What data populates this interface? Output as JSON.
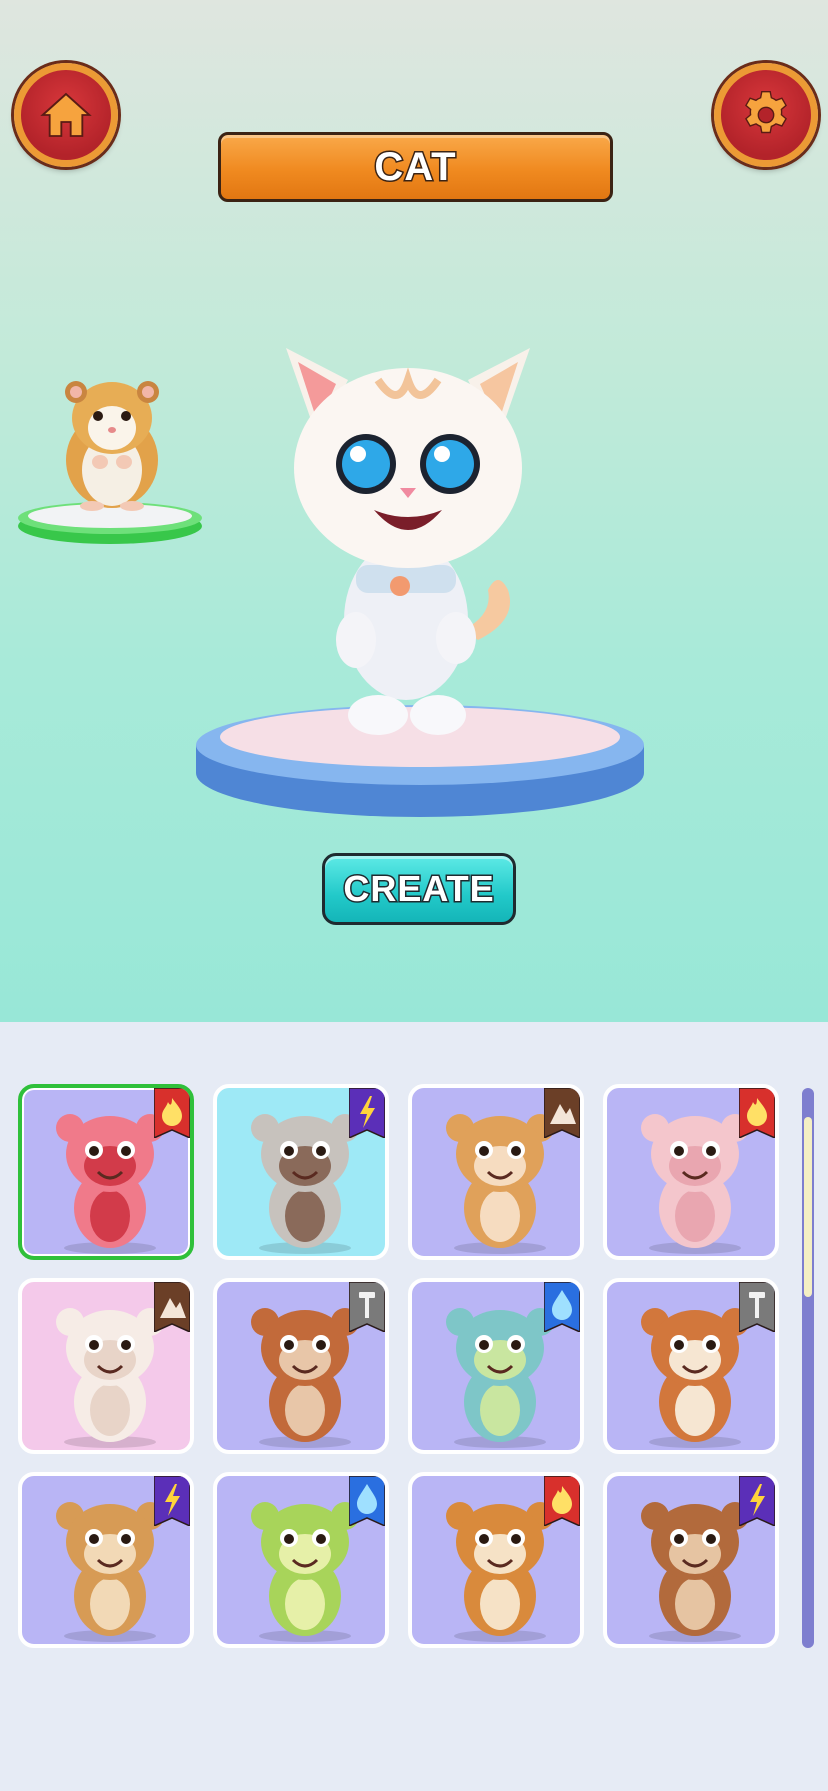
{
  "header": {
    "title": "CAT",
    "home_icon": "home-icon",
    "settings_icon": "gear-icon"
  },
  "stage": {
    "main_character": "cat",
    "side_character": "hamster",
    "create_label": "CREATE"
  },
  "colors": {
    "fire": "#d8302c",
    "lightning": "#5b2fb8",
    "mountain": "#6b3f27",
    "metal": "#7a7a7a",
    "water": "#2a6fe0",
    "selected_border": "#2fc03a"
  },
  "grid": {
    "cards": [
      {
        "animal": "robot-cat",
        "bg": "#b9b5f5",
        "element": "fire",
        "icon": "fire-icon",
        "selected": true
      },
      {
        "animal": "dog",
        "bg": "#9ee9f6",
        "element": "lightning",
        "icon": "lightning-icon",
        "selected": false
      },
      {
        "animal": "monkey",
        "bg": "#b9b5f5",
        "element": "mountain",
        "icon": "mountain-icon",
        "selected": false
      },
      {
        "animal": "pig",
        "bg": "#b9b5f5",
        "element": "fire",
        "icon": "fire-icon",
        "selected": false
      },
      {
        "animal": "fluffy-cat",
        "bg": "#f4c9ea",
        "element": "mountain",
        "icon": "mountain-icon",
        "selected": false
      },
      {
        "animal": "puppy",
        "bg": "#b9b5f5",
        "element": "metal",
        "icon": "screw-icon",
        "selected": false
      },
      {
        "animal": "dragon-mouse",
        "bg": "#b9b5f5",
        "element": "water",
        "icon": "water-drop-icon",
        "selected": false
      },
      {
        "animal": "squirrel",
        "bg": "#b9b5f5",
        "element": "metal",
        "icon": "screw-icon",
        "selected": false
      },
      {
        "animal": "monkey-scarf",
        "bg": "#b9b5f5",
        "element": "lightning",
        "icon": "lightning-icon",
        "selected": false
      },
      {
        "animal": "frog",
        "bg": "#b9b5f5",
        "element": "water",
        "icon": "water-drop-icon",
        "selected": false
      },
      {
        "animal": "tiger",
        "bg": "#b9b5f5",
        "element": "fire",
        "icon": "fire-icon",
        "selected": false
      },
      {
        "animal": "bear",
        "bg": "#b9b5f5",
        "element": "lightning",
        "icon": "lightning-icon",
        "selected": false
      }
    ]
  }
}
